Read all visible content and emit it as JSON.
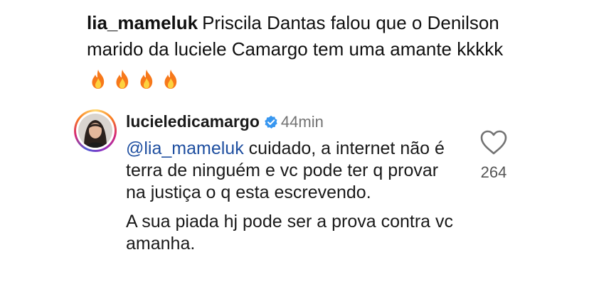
{
  "caption": {
    "username": "lia_mameluk",
    "text": "Priscila Dantas falou que o Denilson marido da luciele Camargo tem uma amante kkkkk",
    "emojis": [
      "fire-icon",
      "fire-icon",
      "fire-icon",
      "fire-icon"
    ]
  },
  "comment": {
    "username": "lucieledicamargo",
    "verified": true,
    "time": "44min",
    "mention": "@lia_mameluk",
    "paragraph1": "cuidado, a internet não é terra de ninguém e vc pode ter q provar na justiça o q esta escrevendo.",
    "paragraph2": "A sua piada hj pode ser a prova contra vc amanha.",
    "likes": "264"
  },
  "colors": {
    "mention": "#1f4fa0",
    "verified_badge": "#3897f0",
    "muted": "#737373"
  }
}
